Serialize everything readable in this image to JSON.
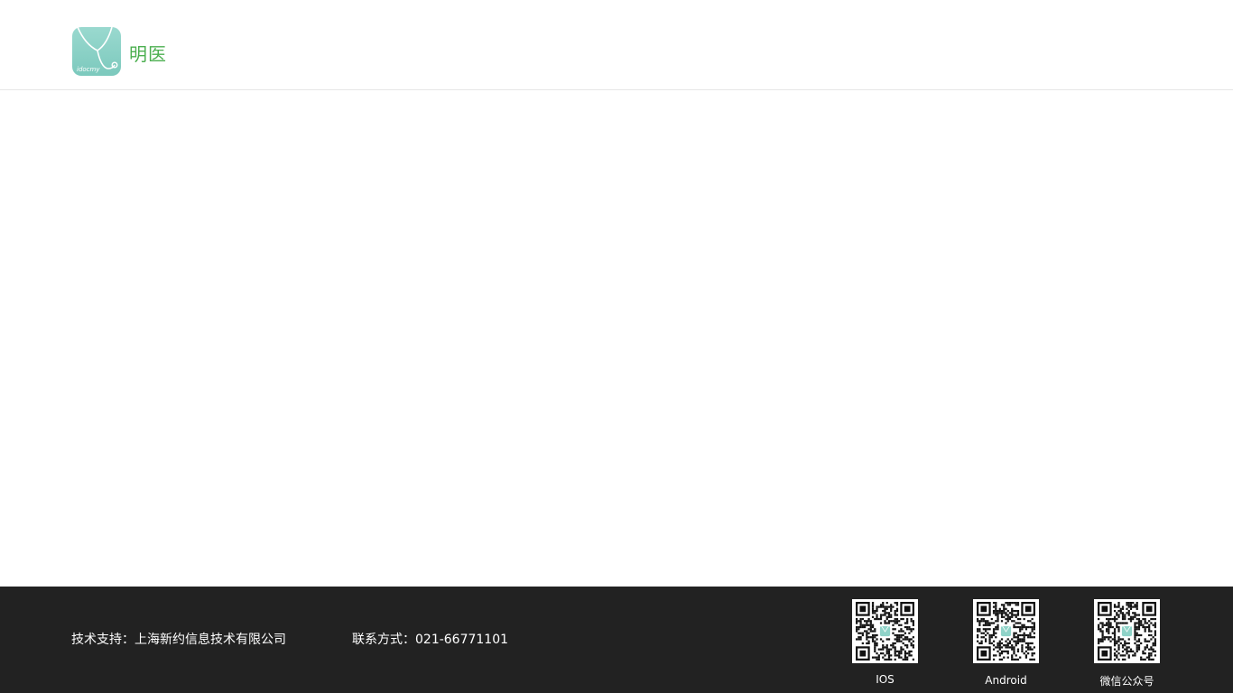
{
  "header": {
    "brand_name": "明医",
    "logo_subtext": "idocmy"
  },
  "footer": {
    "support_text": "技术支持：上海新约信息技术有限公司",
    "contact_text": "联系方式：021-66771101",
    "qr_codes": [
      {
        "label": "IOS"
      },
      {
        "label": "Android"
      },
      {
        "label": "微信公众号"
      }
    ]
  },
  "colors": {
    "brand_green": "#4caf50",
    "logo_teal": "#8fd3c8",
    "footer_bg": "#222222"
  }
}
